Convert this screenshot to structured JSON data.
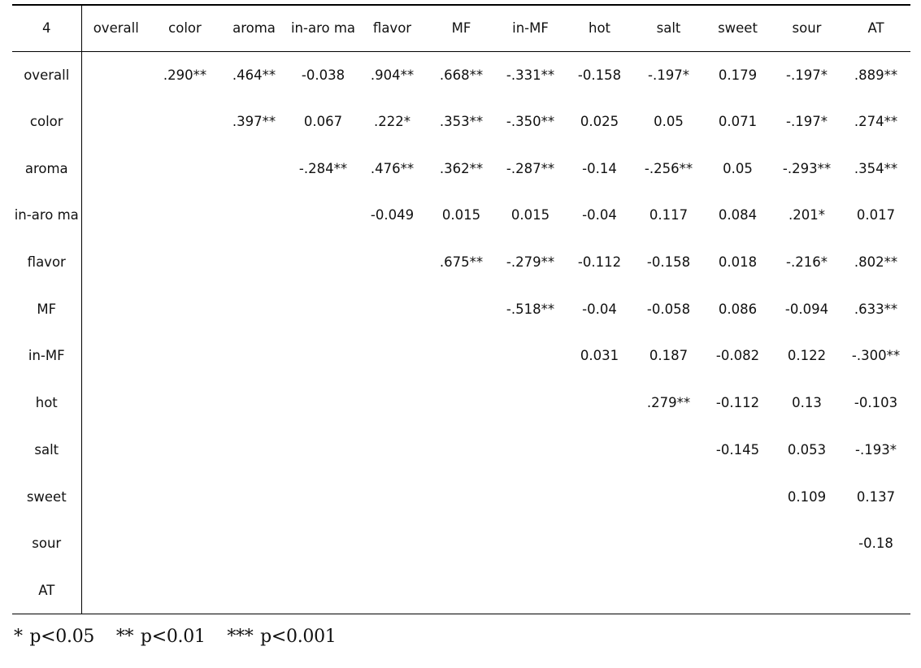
{
  "table": {
    "corner_label": "4",
    "columns": [
      "overall",
      "color",
      "aroma",
      "in-aro ma",
      "flavor",
      "MF",
      "in-MF",
      "hot",
      "salt",
      "sweet",
      "sour",
      "AT"
    ],
    "rows": [
      {
        "label": "overall",
        "cells": [
          "",
          ".290**",
          ".464**",
          "-0.038",
          ".904**",
          ".668**",
          "-.331**",
          "-0.158",
          "-.197*",
          "0.179",
          "-.197*",
          ".889**"
        ]
      },
      {
        "label": "color",
        "cells": [
          "",
          "",
          ".397**",
          "0.067",
          ".222*",
          ".353**",
          "-.350**",
          "0.025",
          "0.05",
          "0.071",
          "-.197*",
          ".274**"
        ]
      },
      {
        "label": "aroma",
        "cells": [
          "",
          "",
          "",
          "-.284**",
          ".476**",
          ".362**",
          "-.287**",
          "-0.14",
          "-.256**",
          "0.05",
          "-.293**",
          ".354**"
        ]
      },
      {
        "label": "in-aro ma",
        "cells": [
          "",
          "",
          "",
          "",
          "-0.049",
          "0.015",
          "0.015",
          "-0.04",
          "0.117",
          "0.084",
          ".201*",
          "0.017"
        ]
      },
      {
        "label": "flavor",
        "cells": [
          "",
          "",
          "",
          "",
          "",
          ".675**",
          "-.279**",
          "-0.112",
          "-0.158",
          "0.018",
          "-.216*",
          ".802**"
        ]
      },
      {
        "label": "MF",
        "cells": [
          "",
          "",
          "",
          "",
          "",
          "",
          "-.518**",
          "-0.04",
          "-0.058",
          "0.086",
          "-0.094",
          ".633**"
        ]
      },
      {
        "label": "in-MF",
        "cells": [
          "",
          "",
          "",
          "",
          "",
          "",
          "",
          "0.031",
          "0.187",
          "-0.082",
          "0.122",
          "-.300**"
        ]
      },
      {
        "label": "hot",
        "cells": [
          "",
          "",
          "",
          "",
          "",
          "",
          "",
          "",
          ".279**",
          "-0.112",
          "0.13",
          "-0.103"
        ]
      },
      {
        "label": "salt",
        "cells": [
          "",
          "",
          "",
          "",
          "",
          "",
          "",
          "",
          "",
          "-0.145",
          "0.053",
          "-.193*"
        ]
      },
      {
        "label": "sweet",
        "cells": [
          "",
          "",
          "",
          "",
          "",
          "",
          "",
          "",
          "",
          "",
          "0.109",
          "0.137"
        ]
      },
      {
        "label": "sour",
        "cells": [
          "",
          "",
          "",
          "",
          "",
          "",
          "",
          "",
          "",
          "",
          "",
          "-0.18"
        ]
      },
      {
        "label": "AT",
        "cells": [
          "",
          "",
          "",
          "",
          "",
          "",
          "",
          "",
          "",
          "",
          "",
          ""
        ]
      }
    ]
  },
  "footnote": {
    "items": [
      "* p<0.05",
      "** p<0.01",
      "*** p<0.001"
    ]
  }
}
